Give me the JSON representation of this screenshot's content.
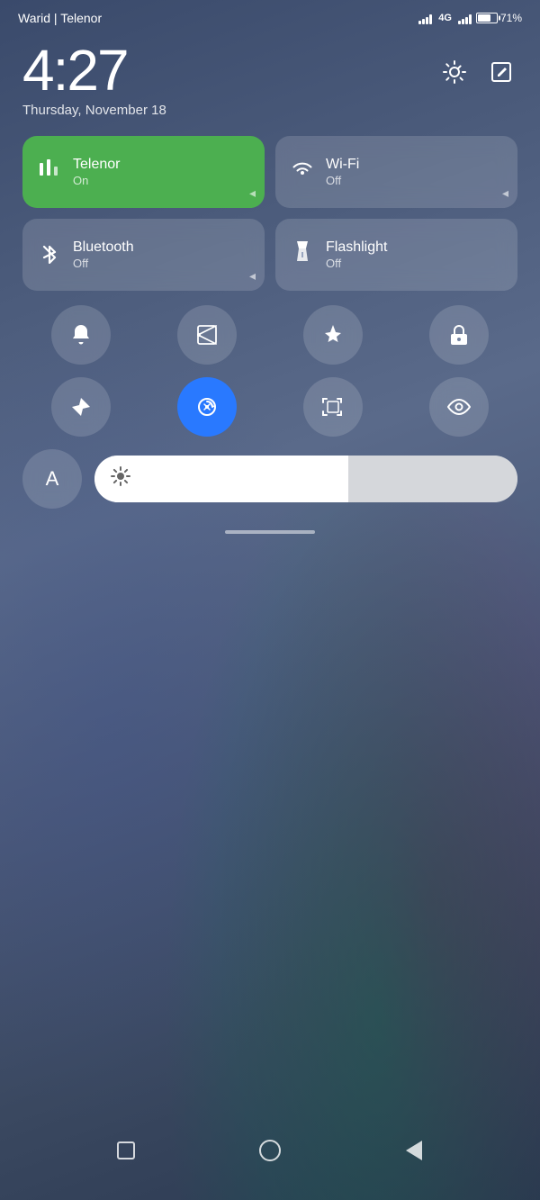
{
  "statusBar": {
    "carrier": "Warid | Telenor",
    "battery": "71%",
    "network": "4G"
  },
  "clock": {
    "time": "4:27",
    "date": "Thursday, November 18"
  },
  "toggles": [
    {
      "id": "telenor",
      "name": "Telenor",
      "status": "On",
      "active": true,
      "icon": "signal"
    },
    {
      "id": "wifi",
      "name": "Wi-Fi",
      "status": "Off",
      "active": false,
      "icon": "wifi"
    },
    {
      "id": "bluetooth",
      "name": "Bluetooth",
      "status": "Off",
      "active": false,
      "icon": "bluetooth"
    },
    {
      "id": "flashlight",
      "name": "Flashlight",
      "status": "Off",
      "active": false,
      "icon": "flashlight"
    }
  ],
  "quickActions": [
    {
      "id": "bell",
      "label": "Notifications",
      "active": false,
      "icon": "🔔"
    },
    {
      "id": "screenshot",
      "label": "Screenshot",
      "active": false,
      "icon": "scissors"
    },
    {
      "id": "airplane",
      "label": "Airplane Mode",
      "active": false,
      "icon": "✈"
    },
    {
      "id": "lock",
      "label": "Lock",
      "active": false,
      "icon": "🔒"
    },
    {
      "id": "location",
      "label": "Location",
      "active": false,
      "icon": "location"
    },
    {
      "id": "autorotate",
      "label": "Auto Rotate",
      "active": true,
      "icon": "rotate"
    },
    {
      "id": "scan",
      "label": "Scan",
      "active": false,
      "icon": "scan"
    },
    {
      "id": "eye",
      "label": "Eye Comfort",
      "active": false,
      "icon": "👁"
    }
  ],
  "brightness": {
    "label": "Brightness",
    "level": 60
  },
  "navbar": {
    "recent": "Recent Apps",
    "home": "Home",
    "back": "Back"
  }
}
